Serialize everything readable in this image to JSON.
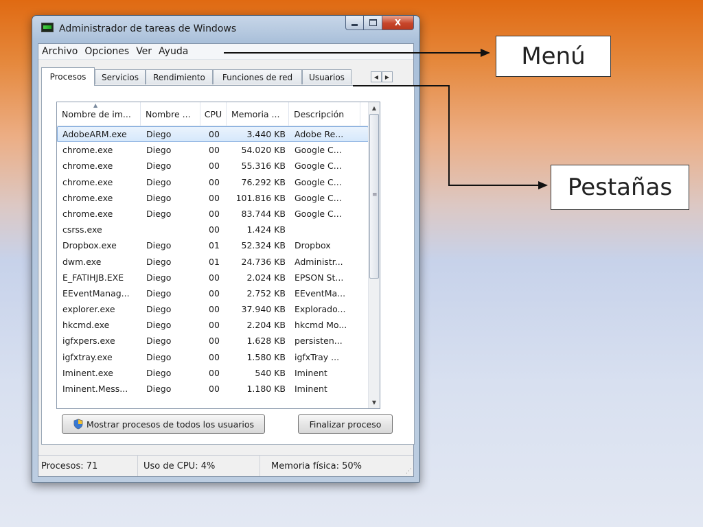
{
  "window": {
    "title": "Administrador de tareas de Windows",
    "close_glyph": "X"
  },
  "menu": [
    "Archivo",
    "Opciones",
    "Ver",
    "Ayuda"
  ],
  "tabs": [
    "Procesos",
    "Servicios",
    "Rendimiento",
    "Funciones de red",
    "Usuarios"
  ],
  "active_tab": "Procesos",
  "list": {
    "columns": [
      "Nombre de im...",
      "Nombre ...",
      "CPU",
      "Memoria ...",
      "Descripción"
    ],
    "rows": [
      [
        "AdobeARM.exe",
        "Diego",
        "00",
        "3.440 KB",
        "Adobe Re..."
      ],
      [
        "chrome.exe",
        "Diego",
        "00",
        "54.020 KB",
        "Google C..."
      ],
      [
        "chrome.exe",
        "Diego",
        "00",
        "55.316 KB",
        "Google C..."
      ],
      [
        "chrome.exe",
        "Diego",
        "00",
        "76.292 KB",
        "Google C..."
      ],
      [
        "chrome.exe",
        "Diego",
        "00",
        "101.816 KB",
        "Google C..."
      ],
      [
        "chrome.exe",
        "Diego",
        "00",
        "83.744 KB",
        "Google C..."
      ],
      [
        "csrss.exe",
        "",
        "00",
        "1.424 KB",
        ""
      ],
      [
        "Dropbox.exe",
        "Diego",
        "01",
        "52.324 KB",
        "Dropbox"
      ],
      [
        "dwm.exe",
        "Diego",
        "01",
        "24.736 KB",
        "Administr..."
      ],
      [
        "E_FATIHJB.EXE",
        "Diego",
        "00",
        "2.024 KB",
        "EPSON St..."
      ],
      [
        "EEventManag...",
        "Diego",
        "00",
        "2.752 KB",
        "EEventMa..."
      ],
      [
        "explorer.exe",
        "Diego",
        "00",
        "37.940 KB",
        "Explorado..."
      ],
      [
        "hkcmd.exe",
        "Diego",
        "00",
        "2.204 KB",
        "hkcmd Mo..."
      ],
      [
        "igfxpers.exe",
        "Diego",
        "00",
        "1.628 KB",
        "persisten..."
      ],
      [
        "igfxtray.exe",
        "Diego",
        "00",
        "1.580 KB",
        "igfxTray ..."
      ],
      [
        "Iminent.exe",
        "Diego",
        "00",
        "540 KB",
        "Iminent"
      ],
      [
        "Iminent.Mess...",
        "Diego",
        "00",
        "1.180 KB",
        "Iminent"
      ]
    ],
    "selected_row": 0
  },
  "buttons": {
    "show_all": "Mostrar procesos de todos los usuarios",
    "end_process": "Finalizar proceso"
  },
  "status": {
    "processes": "Procesos: 71",
    "cpu": "Uso de CPU: 4%",
    "memory": "Memoria física: 50%"
  },
  "callouts": {
    "menu": "Menú",
    "tabs": "Pestañas"
  },
  "icons": {
    "app": "task-manager-icon",
    "shield": "uac-shield-icon",
    "sort": "sort-ascending-icon"
  }
}
